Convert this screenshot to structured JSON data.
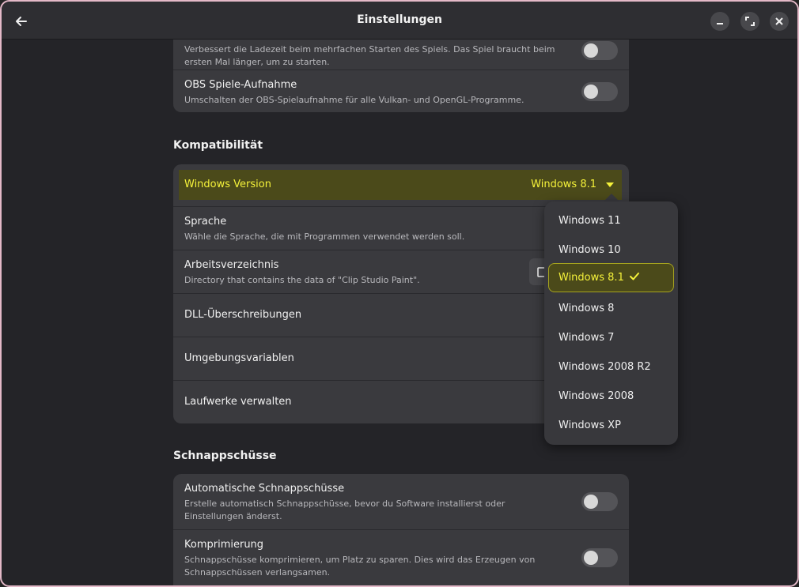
{
  "window": {
    "title": "Einstellungen"
  },
  "top_card": {
    "rows": [
      {
        "subtitle": "Verbessert die Ladezeit beim mehrfachen Starten des Spiels. Das Spiel braucht beim ersten Mal länger, um zu starten."
      },
      {
        "title": "OBS Spiele-Aufnahme",
        "subtitle": "Umschalten der OBS-Spielaufnahme für alle Vulkan- und OpenGL-Programme."
      }
    ]
  },
  "compat": {
    "heading": "Kompatibilität",
    "windows_version": {
      "label": "Windows Version",
      "value": "Windows 8.1"
    },
    "rows": [
      {
        "title": "Sprache",
        "subtitle": "Wähle die Sprache, die mit Programmen verwendet werden soll."
      },
      {
        "title": "Arbeitsverzeichnis",
        "subtitle": "Directory that contains the data of \"Clip Studio Paint\"."
      },
      {
        "title": "DLL-Überschreibungen"
      },
      {
        "title": "Umgebungsvariablen"
      },
      {
        "title": "Laufwerke verwalten"
      }
    ]
  },
  "snapshots": {
    "heading": "Schnappschüsse",
    "rows": [
      {
        "title": "Automatische Schnappschüsse",
        "subtitle": "Erstelle automatisch Schnappschüsse, bevor du Software installierst oder Einstellungen änderst."
      },
      {
        "title": "Komprimierung",
        "subtitle": "Schnappschüsse komprimieren, um Platz zu sparen. Dies wird das Erzeugen von Schnappschüssen verlangsamen."
      }
    ]
  },
  "version_popover": {
    "options": [
      "Windows 11",
      "Windows 10",
      "Windows 8.1",
      "Windows 8",
      "Windows 7",
      "Windows 2008 R2",
      "Windows 2008",
      "Windows XP"
    ],
    "selected": "Windows 8.1"
  },
  "colors": {
    "accent": "#f5f23a",
    "highlight_bg": "#4b4a1a",
    "frame": "#e4b9c8"
  }
}
